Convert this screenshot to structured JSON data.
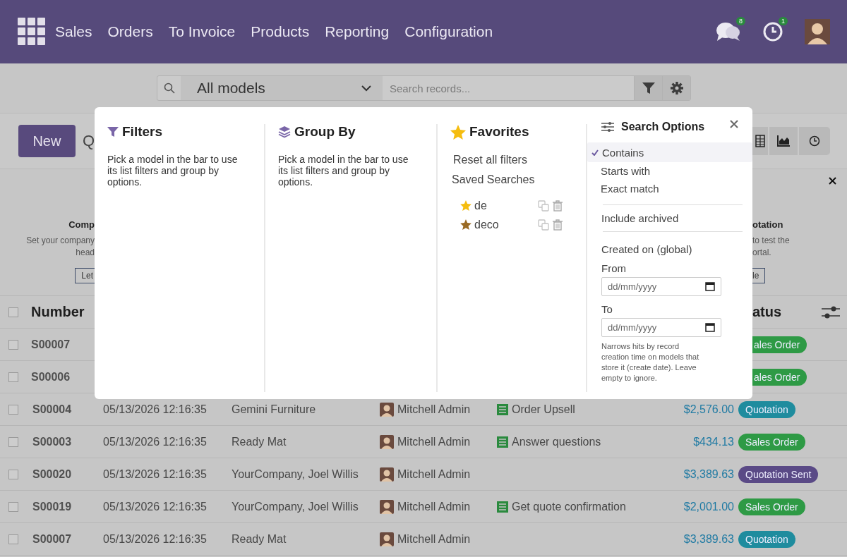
{
  "navbar": {
    "menu": [
      "Sales",
      "Orders",
      "To Invoice",
      "Products",
      "Reporting",
      "Configuration"
    ],
    "messages_badge": "8",
    "activities_badge": "1"
  },
  "search": {
    "model": "All models",
    "placeholder": "Search records..."
  },
  "control_panel": {
    "new_button": "New",
    "title": "Q"
  },
  "banner": {
    "left": {
      "title": "Comp",
      "lines": [
        "Set your company",
        "head"
      ],
      "button": "Let"
    },
    "right": {
      "title": "otation",
      "lines": [
        "to test the",
        "ortal."
      ],
      "button": "le"
    }
  },
  "table": {
    "all_checked": false,
    "first_column": "Number",
    "last_column": "atus",
    "partial_rows": [
      {
        "number": "S00007",
        "status": "ales Order",
        "color": "#2e9a45",
        "checked": false
      },
      {
        "number": "S00006",
        "status": "ales Order",
        "color": "#2e9a45",
        "checked": false
      }
    ],
    "rows": [
      {
        "number": "S00004",
        "date": "05/13/2026 12:16:35",
        "customer": "Gemini Furniture",
        "salesperson": "Mitchell Admin",
        "activity": "Order Upsell",
        "total": "$2,576.00",
        "status": "Quotation",
        "color": "#1f8c9e",
        "checked": false
      },
      {
        "number": "S00003",
        "date": "05/13/2026 12:16:35",
        "customer": "Ready Mat",
        "salesperson": "Mitchell Admin",
        "activity": "Answer questions",
        "total": "$434.13",
        "status": "Sales Order",
        "color": "#2e9a45",
        "checked": false
      },
      {
        "number": "S00020",
        "date": "05/13/2026 12:16:35",
        "customer": "YourCompany, Joel Willis",
        "salesperson": "Mitchell Admin",
        "total": "$3,389.63",
        "status": "Quotation Sent",
        "color": "#5a4a86",
        "checked": false
      },
      {
        "number": "S00019",
        "date": "05/13/2026 12:16:35",
        "customer": "YourCompany, Joel Willis",
        "salesperson": "Mitchell Admin",
        "activity": "Get quote confirmation",
        "total": "$2,001.00",
        "status": "Sales Order",
        "color": "#2e9a45",
        "checked": false
      },
      {
        "number": "S00007",
        "date": "05/13/2026 12:16:35",
        "customer": "Ready Mat",
        "salesperson": "Mitchell Admin",
        "total": "$3,389.63",
        "status": "Quotation",
        "color": "#1f8c9e",
        "checked": false
      }
    ]
  },
  "search_panel": {
    "filters": {
      "title": "Filters",
      "text": "Pick a model in the bar to use its list filters and group by options."
    },
    "group_by": {
      "title": "Group By",
      "text": "Pick a model in the bar to use its list filters and group by options."
    },
    "favorites": {
      "title": "Favorites",
      "actions": [
        "Reset all filters",
        "Saved Searches"
      ],
      "saved": [
        {
          "name": "de",
          "color": "#f5bd10"
        },
        {
          "name": "deco",
          "color": "#9a6a24"
        }
      ]
    },
    "search_options": {
      "title": "Search Options",
      "match_modes": [
        {
          "label": "Contains",
          "selected": true
        },
        {
          "label": "Starts with",
          "selected": false
        },
        {
          "label": "Exact match",
          "selected": false
        }
      ],
      "include_archived": "Include archived",
      "created_on": "Created on (global)",
      "from_label": "From",
      "from_placeholder": "dd/mm/yyyy",
      "to_label": "To",
      "to_placeholder": "dd/mm/yyyy",
      "hint": "Narrows hits by record creation time on models that store it (create date). Leave empty to ignore."
    }
  }
}
